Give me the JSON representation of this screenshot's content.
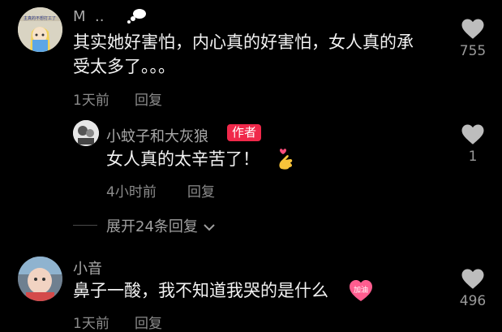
{
  "comments": [
    {
      "username": "M  ..",
      "avatar_caption": "主真的不想打工了",
      "text_line1": "其实她好害怕，内心真的好害怕，女人真的承",
      "text_line2": "受太多了。。。",
      "time": "1天前",
      "reply_label": "回复",
      "likes": "755"
    },
    {
      "username": "小蚊子和大灰狼",
      "badge": "作者",
      "text": "女人真的太辛苦了！",
      "time": "4小时前",
      "reply_label": "回复",
      "likes": "1"
    },
    {
      "username": "小音",
      "text": "鼻子一酸，我不知道我哭的是什么",
      "sticker_text": "加油",
      "time": "1天前",
      "reply_label": "回复",
      "likes": "496"
    }
  ],
  "expand_replies_label": "展开24条回复",
  "icons": {
    "like": "heart-icon",
    "expand": "chevron-down-icon",
    "emoji_heart": "finger-heart-emoji"
  },
  "colors": {
    "background": "#000000",
    "author_badge": "#f0284a",
    "text": "#f2f2f2",
    "secondary": "#8c8c8c"
  }
}
